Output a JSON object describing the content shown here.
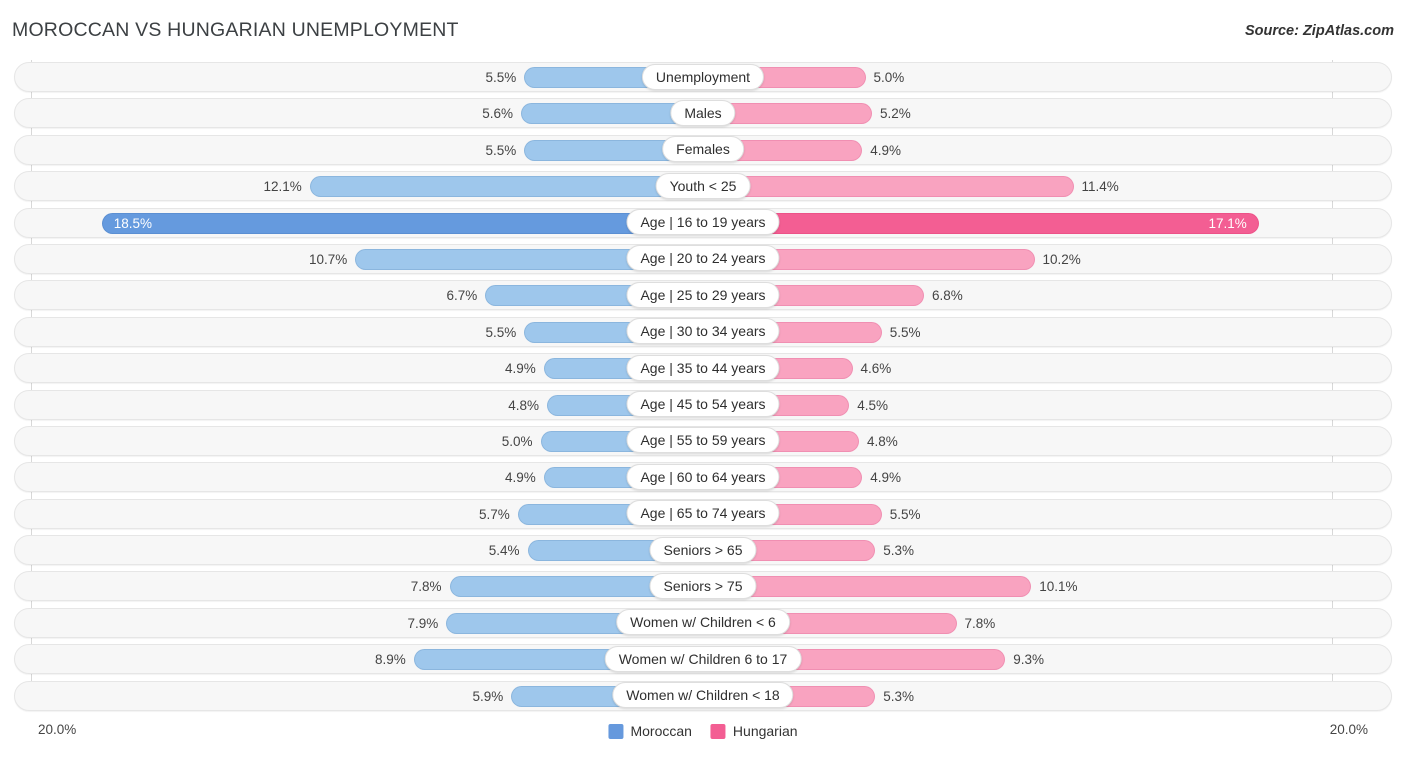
{
  "header": {
    "title": "MOROCCAN VS HUNGARIAN UNEMPLOYMENT",
    "source": "Source: ZipAtlas.com"
  },
  "footer": {
    "axis_left": "20.0%",
    "axis_right": "20.0%",
    "legend": [
      {
        "label": "Moroccan",
        "color": "#6699dd"
      },
      {
        "label": "Hungarian",
        "color": "#f35e93"
      }
    ]
  },
  "colors": {
    "left_bar": "#9ec7ec",
    "left_bar_accent": "#659ade",
    "right_bar": "#f9a3c0",
    "right_bar_accent": "#f35e93",
    "track": "#f7f7f7",
    "pill": "#ffffff"
  },
  "chart_data": {
    "type": "bar",
    "orientation": "horizontal-diverging",
    "title": "MOROCCAN VS HUNGARIAN UNEMPLOYMENT",
    "xlabel": "",
    "ylabel": "",
    "axis_max": 20.0,
    "unit": "%",
    "grid": false,
    "legend_position": "bottom-center",
    "categories": [
      "Unemployment",
      "Males",
      "Females",
      "Youth < 25",
      "Age | 16 to 19 years",
      "Age | 20 to 24 years",
      "Age | 25 to 29 years",
      "Age | 30 to 34 years",
      "Age | 35 to 44 years",
      "Age | 45 to 54 years",
      "Age | 55 to 59 years",
      "Age | 60 to 64 years",
      "Age | 65 to 74 years",
      "Seniors > 65",
      "Seniors > 75",
      "Women w/ Children < 6",
      "Women w/ Children 6 to 17",
      "Women w/ Children < 18"
    ],
    "series": [
      {
        "name": "Moroccan",
        "side": "left",
        "color": "#9ec7ec",
        "values": [
          5.5,
          5.6,
          5.5,
          12.1,
          18.5,
          10.7,
          6.7,
          5.5,
          4.9,
          4.8,
          5.0,
          4.9,
          5.7,
          5.4,
          7.8,
          7.9,
          8.9,
          5.9
        ],
        "labels": [
          "5.5%",
          "5.6%",
          "5.5%",
          "12.1%",
          "18.5%",
          "10.7%",
          "6.7%",
          "5.5%",
          "4.9%",
          "4.8%",
          "5.0%",
          "4.9%",
          "5.7%",
          "5.4%",
          "7.8%",
          "7.9%",
          "8.9%",
          "5.9%"
        ]
      },
      {
        "name": "Hungarian",
        "side": "right",
        "color": "#f9a3c0",
        "values": [
          5.0,
          5.2,
          4.9,
          11.4,
          17.1,
          10.2,
          6.8,
          5.5,
          4.6,
          4.5,
          4.8,
          4.9,
          5.5,
          5.3,
          10.1,
          7.8,
          9.3,
          5.3
        ],
        "labels": [
          "5.0%",
          "5.2%",
          "4.9%",
          "11.4%",
          "17.1%",
          "10.2%",
          "6.8%",
          "5.5%",
          "4.6%",
          "4.5%",
          "4.8%",
          "4.9%",
          "5.5%",
          "5.3%",
          "10.1%",
          "7.8%",
          "9.3%",
          "5.3%"
        ]
      }
    ],
    "highlighted_row": "Age | 16 to 19 years"
  }
}
